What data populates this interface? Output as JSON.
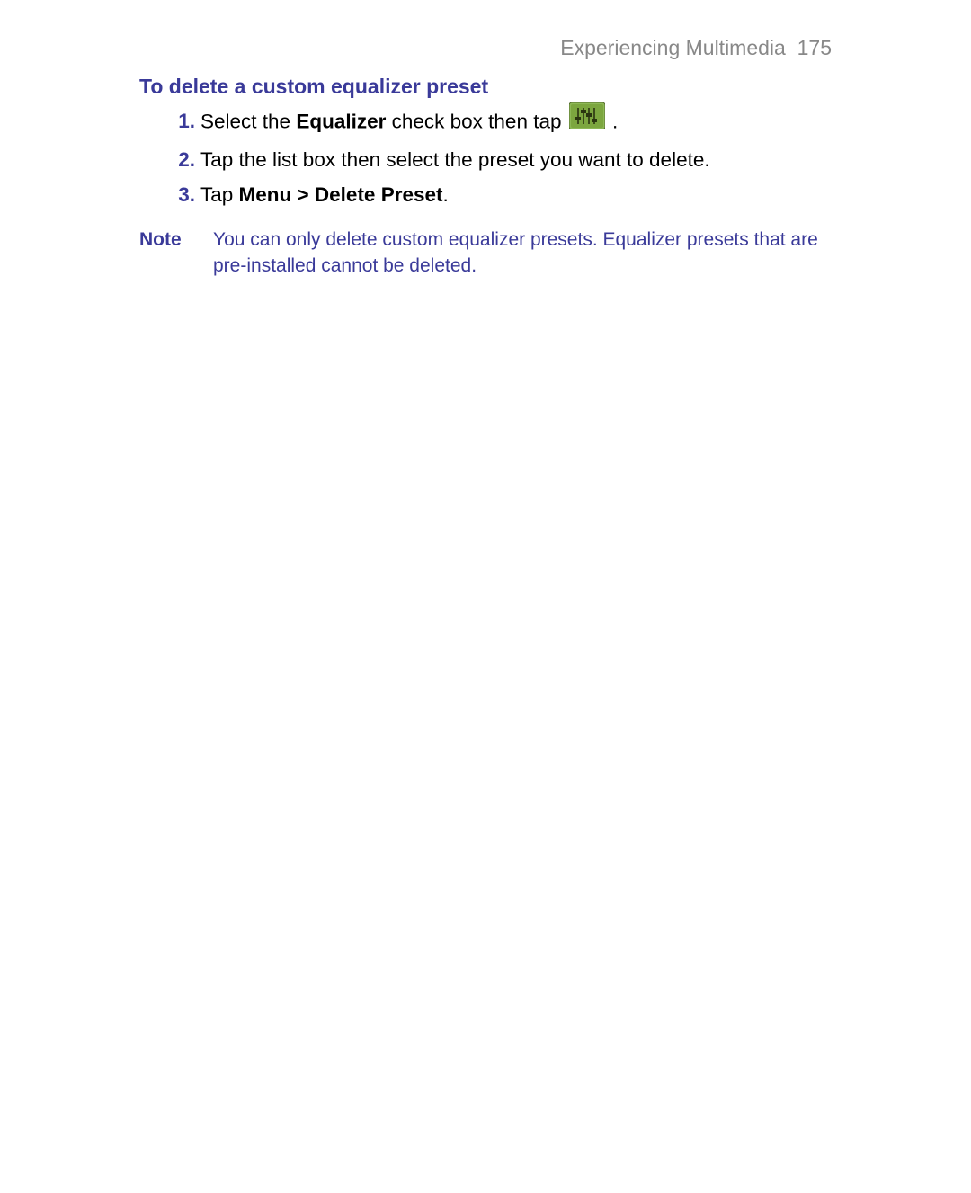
{
  "header": {
    "chapter": "Experiencing Multimedia",
    "page_number": "175"
  },
  "section": {
    "heading": "To delete a custom equalizer preset"
  },
  "steps": [
    {
      "number": "1.",
      "prefix": "Select the ",
      "bold1": "Equalizer",
      "mid": " check box then tap ",
      "suffix": " ."
    },
    {
      "number": "2.",
      "text": "Tap the list box then select the preset you want to delete."
    },
    {
      "number": "3.",
      "prefix": "Tap ",
      "bold1": "Menu > Delete Preset",
      "suffix": "."
    }
  ],
  "note": {
    "label": "Note",
    "text": "You can only delete custom equalizer presets. Equalizer presets that are pre-installed cannot be deleted."
  }
}
